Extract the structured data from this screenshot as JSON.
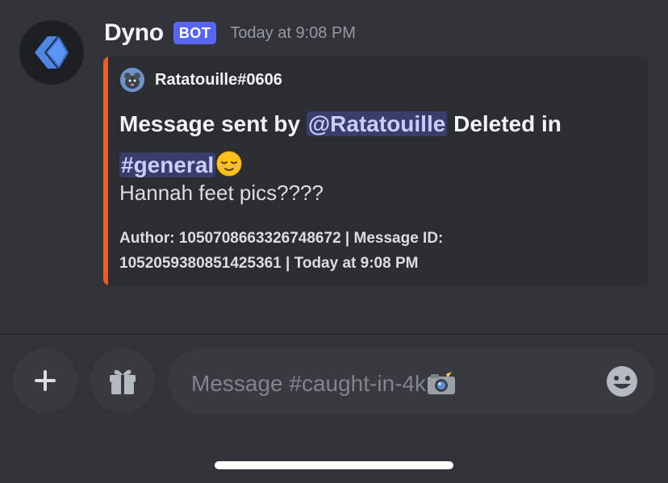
{
  "message": {
    "username": "Dyno",
    "badge": "BOT",
    "timestamp": "Today at 9:08 PM",
    "avatar_icon": "dyno-logo-icon"
  },
  "embed": {
    "accent_color": "#e85d2c",
    "author_name": "Ratatouille#0606",
    "author_avatar_icon": "rat-avatar-icon",
    "title_prefix": "Message sent by ",
    "title_mention": "@Ratatouille",
    "title_middle": " Deleted in",
    "title_channel": "#general",
    "title_emoji": "relieved-face-emoji",
    "description": "Hannah feet pics????",
    "footer_line1": "Author: 1050708663326748672 | Message ID:",
    "footer_line2": "1052059380851425361 | Today at 9:08 PM"
  },
  "composer": {
    "plus_icon": "plus-icon",
    "gift_icon": "gift-icon",
    "placeholder": "Message #caught-in-4k",
    "placeholder_emoji": "camera-flash-emoji",
    "emoji_icon": "smile-emoji-icon"
  },
  "colors": {
    "background": "#313338",
    "embed_bg": "#2b2d31",
    "bot_badge": "#5865f2",
    "mention_text": "#c9cdfb"
  }
}
